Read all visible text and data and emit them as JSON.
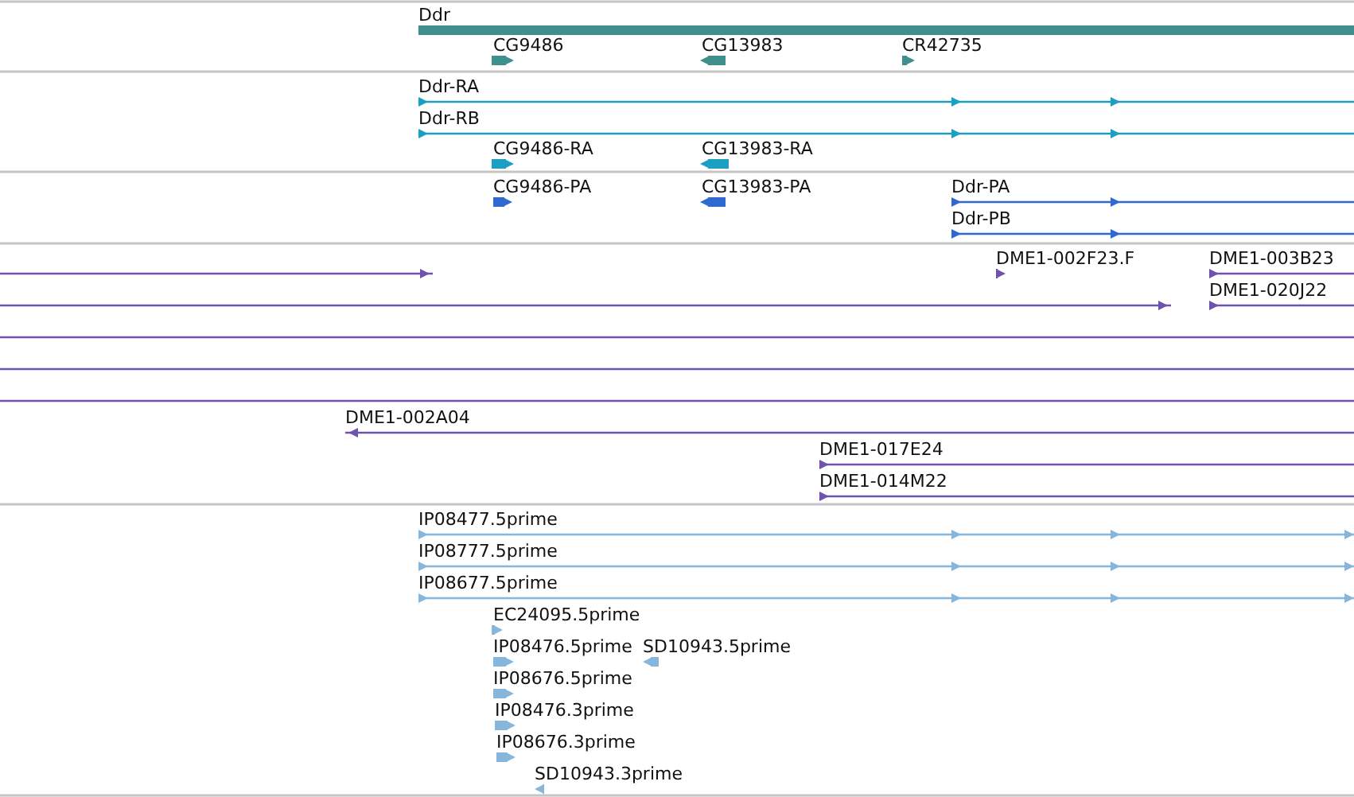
{
  "tracks": [
    {
      "color": "#3f8f8f",
      "features": [
        {
          "label": "Ddr",
          "kind": "gene"
        },
        {
          "label": "CG9486",
          "kind": "block",
          "reverse": false
        },
        {
          "label": "CG13983",
          "kind": "block",
          "reverse": true
        },
        {
          "label": "CR42735",
          "kind": "block",
          "reverse": false
        }
      ]
    },
    {
      "color": "#1c9fc2",
      "features": [
        {
          "label": "Ddr-RA",
          "kind": "line",
          "reverse": false
        },
        {
          "label": "Ddr-RB",
          "kind": "line",
          "reverse": false
        },
        {
          "label": "CG9486-RA",
          "kind": "block",
          "reverse": false
        },
        {
          "label": "CG13983-RA",
          "kind": "block",
          "reverse": true
        }
      ]
    },
    {
      "color": "#2f69cf",
      "features": [
        {
          "label": "CG9486-PA",
          "kind": "block",
          "reverse": false
        },
        {
          "label": "CG13983-PA",
          "kind": "block",
          "reverse": true
        },
        {
          "label": "Ddr-PA",
          "kind": "line",
          "reverse": false
        },
        {
          "label": "Ddr-PB",
          "kind": "line",
          "reverse": false
        }
      ]
    },
    {
      "color": "#6f52b0",
      "features": [
        {
          "kind": "line",
          "reverse": false
        },
        {
          "label": "DME1-002F23.F",
          "kind": "block",
          "reverse": false
        },
        {
          "label": "DME1-003B23",
          "kind": "line",
          "reverse": false
        },
        {
          "kind": "line",
          "reverse": false
        },
        {
          "label": "DME1-020J22",
          "kind": "line",
          "reverse": false
        },
        {
          "kind": "line"
        },
        {
          "kind": "line"
        },
        {
          "kind": "line"
        },
        {
          "label": "DME1-002A04",
          "kind": "line",
          "reverse": true
        },
        {
          "label": "DME1-017E24",
          "kind": "line",
          "reverse": false
        },
        {
          "label": "DME1-014M22",
          "kind": "line",
          "reverse": false
        }
      ]
    },
    {
      "color": "#86b6dc",
      "features": [
        {
          "label": "IP08477.5prime",
          "kind": "line",
          "reverse": false
        },
        {
          "label": "IP08777.5prime",
          "kind": "line",
          "reverse": false
        },
        {
          "label": "IP08677.5prime",
          "kind": "line",
          "reverse": false
        },
        {
          "label": "EC24095.5prime",
          "kind": "block",
          "reverse": false
        },
        {
          "label": "IP08476.5prime",
          "kind": "block",
          "reverse": false
        },
        {
          "label": "SD10943.5prime",
          "kind": "block",
          "reverse": true
        },
        {
          "label": "IP08676.5prime",
          "kind": "block",
          "reverse": false
        },
        {
          "label": "IP08476.3prime",
          "kind": "block",
          "reverse": false
        },
        {
          "label": "IP08676.3prime",
          "kind": "block",
          "reverse": false
        },
        {
          "label": "SD10943.3prime",
          "kind": "block",
          "reverse": true
        }
      ]
    }
  ]
}
